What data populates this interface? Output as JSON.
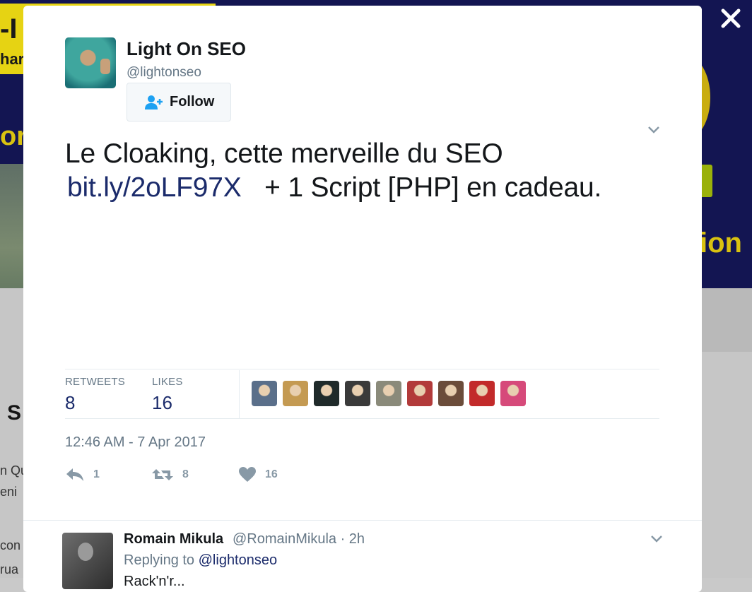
{
  "background": {
    "banner_line1": "-I",
    "banner_line2": "har",
    "banner_or": "or",
    "banner_ion": "ion",
    "article_initial": "S",
    "article_line1": "n Qu",
    "article_line2": "eni",
    "article_line3": "con",
    "article_line4": "rua"
  },
  "close": {
    "icon": "close-icon"
  },
  "tweet": {
    "author_name": "Light On SEO",
    "author_handle": "@lightonseo",
    "follow_label": "Follow",
    "text_line1": "Le Cloaking, cette merveille du SEO",
    "link": "bit.ly/2oLF97X",
    "text_after_link": "+ 1 Script [PHP] en cadeau.",
    "stats": [
      {
        "label": "RETWEETS",
        "value": "8"
      },
      {
        "label": "LIKES",
        "value": "16"
      }
    ],
    "likers": [
      {
        "icon": "liker-avatar-1",
        "color": "#5a6f8a"
      },
      {
        "icon": "liker-avatar-2",
        "color": "#c49a52"
      },
      {
        "icon": "liker-avatar-3",
        "color": "#1f2a2a"
      },
      {
        "icon": "liker-avatar-4",
        "color": "#3a3a3a"
      },
      {
        "icon": "liker-avatar-5",
        "color": "#8a8a7a"
      },
      {
        "icon": "liker-avatar-6",
        "color": "#b23a3a"
      },
      {
        "icon": "liker-avatar-7",
        "color": "#6b4c3a"
      },
      {
        "icon": "liker-avatar-8",
        "color": "#c22a2a"
      },
      {
        "icon": "liker-avatar-9",
        "color": "#d64a7a"
      }
    ],
    "timestamp": "12:46 AM - 7 Apr 2017",
    "actions": {
      "reply_count": "1",
      "retweet_count": "8",
      "like_count": "16"
    }
  },
  "reply": {
    "name": "Romain Mikula",
    "handle": "@RomainMikula · 2h",
    "replying_prefix": "Replying to",
    "replying_mention": "@lightonseo",
    "text": "Rack'n'r..."
  },
  "colors": {
    "link": "#1b2b6b",
    "muted": "#657786",
    "banner": "#131552",
    "accent_yellow": "#e6d313"
  }
}
